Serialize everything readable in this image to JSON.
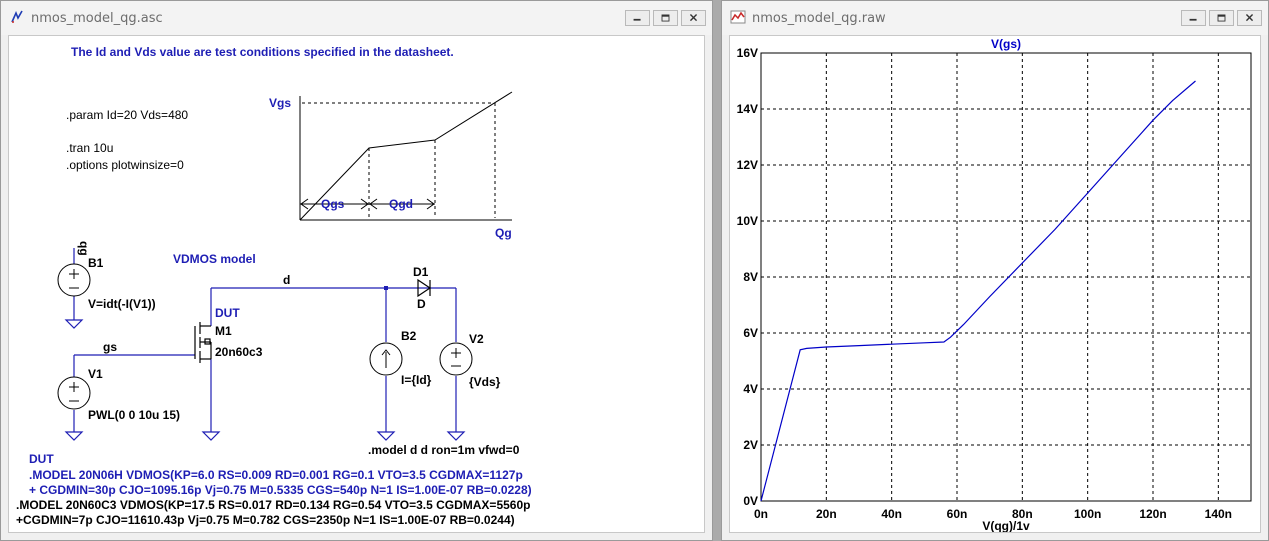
{
  "left_window": {
    "title": "nmos_model_qg.asc",
    "schematic": {
      "header_note": "The Id and Vds value are test conditions specified in the datasheet.",
      "param": ".param Id=20 Vds=480",
      "tran": ".tran 10u",
      "options": ".options plotwinsize=0",
      "diagram": {
        "vgs": "Vgs",
        "qg": "Qg",
        "qgs": "Qgs",
        "qgd": "Qgd"
      },
      "vdmos_label": "VDMOS model",
      "qg_label": "qg",
      "b1": {
        "name": "B1",
        "value": "V=idt(-I(V1))"
      },
      "net_d": "d",
      "d1": {
        "name": "D1",
        "model": "D"
      },
      "dut": {
        "label": "DUT",
        "name": "M1",
        "model": "20n60c3"
      },
      "net_gs": "gs",
      "b2": {
        "name": "B2",
        "value": "I={Id}"
      },
      "v2": {
        "name": "V2",
        "value": "{Vds}"
      },
      "v1": {
        "name": "V1",
        "value": "PWL(0 0 10u 15)"
      },
      "model_d": ".model d d ron=1m vfwd=0",
      "dut_block_label": "DUT",
      "model_20n06h_1": ".MODEL 20N06H VDMOS(KP=6.0 RS=0.009 RD=0.001 RG=0.1 VTO=3.5 CGDMAX=1127p",
      "model_20n06h_2": "+ CGDMIN=30p CJO=1095.16p Vj=0.75 M=0.5335 CGS=540p N=1 IS=1.00E-07 RB=0.0228)",
      "model_20n60c3_1": ".MODEL 20N60C3 VDMOS(KP=17.5 RS=0.017 RD=0.134 RG=0.54 VTO=3.5 CGDMAX=5560p",
      "model_20n60c3_2": "+CGDMIN=7p CJO=11610.43p Vj=0.75 M=0.782 CGS=2350p N=1 IS=1.00E-07 RB=0.0244)"
    }
  },
  "right_window": {
    "title": "nmos_model_qg.raw"
  },
  "colors": {
    "schematic_blue": "#1e1eb4",
    "trace": "#0000c8",
    "grid": "#000000"
  },
  "chart_data": {
    "type": "line",
    "title": "V(gs)",
    "xlabel": "V(qg)/1v",
    "ylabel": "",
    "xlim": [
      0,
      150
    ],
    "ylim": [
      0,
      16
    ],
    "x_ticks": [
      0,
      20,
      40,
      60,
      80,
      100,
      120,
      140
    ],
    "x_tick_labels": [
      "0n",
      "20n",
      "40n",
      "60n",
      "80n",
      "100n",
      "120n",
      "140n"
    ],
    "y_ticks": [
      0,
      2,
      4,
      6,
      8,
      10,
      12,
      14,
      16
    ],
    "y_tick_labels": [
      "0V",
      "2V",
      "4V",
      "6V",
      "8V",
      "10V",
      "12V",
      "14V",
      "16V"
    ],
    "grid": true,
    "series": [
      {
        "name": "V(gs)",
        "x": [
          0,
          12,
          14,
          20,
          30,
          40,
          50,
          56,
          58,
          62,
          70,
          80,
          90,
          100,
          110,
          120,
          126,
          133
        ],
        "y": [
          0,
          5.4,
          5.45,
          5.5,
          5.55,
          5.6,
          5.65,
          5.68,
          5.85,
          6.3,
          7.3,
          8.5,
          9.7,
          11.0,
          12.3,
          13.6,
          14.3,
          15.0
        ]
      }
    ]
  }
}
